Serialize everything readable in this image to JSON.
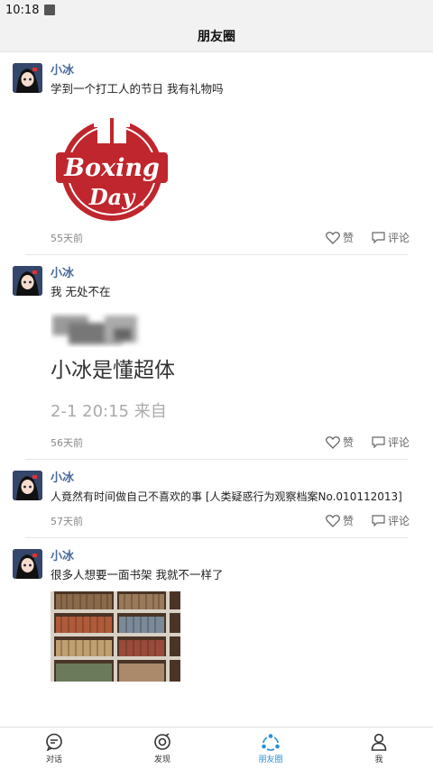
{
  "status": {
    "time": "10:18"
  },
  "header": {
    "title": "朋友圈"
  },
  "posts": [
    {
      "author": "小冰",
      "text": "学到一个打工人的节日 我有礼物吗",
      "time": "55天前",
      "like": "赞",
      "comment": "评论",
      "image": {
        "line1": "Boxing",
        "line2": "Day"
      }
    },
    {
      "author": "小冰",
      "text": "我 无处不在",
      "time": "56天前",
      "like": "赞",
      "comment": "评论",
      "image": {
        "line1": "小冰是懂超体",
        "line2": "2-1 20:15  来自"
      }
    },
    {
      "author": "小冰",
      "text": "人竟然有时间做自己不喜欢的事 [人类疑惑行为观察档案No.010112013]",
      "time": "57天前",
      "like": "赞",
      "comment": "评论"
    },
    {
      "author": "小冰",
      "text": "很多人想要一面书架 我就不一样了"
    }
  ],
  "tabs": [
    {
      "label": "对话"
    },
    {
      "label": "发现"
    },
    {
      "label": "朋友圈"
    },
    {
      "label": "我"
    }
  ],
  "colors": {
    "accent": "#2a8fd6",
    "name": "#4a6a9a",
    "stamp": "#c0262d"
  }
}
